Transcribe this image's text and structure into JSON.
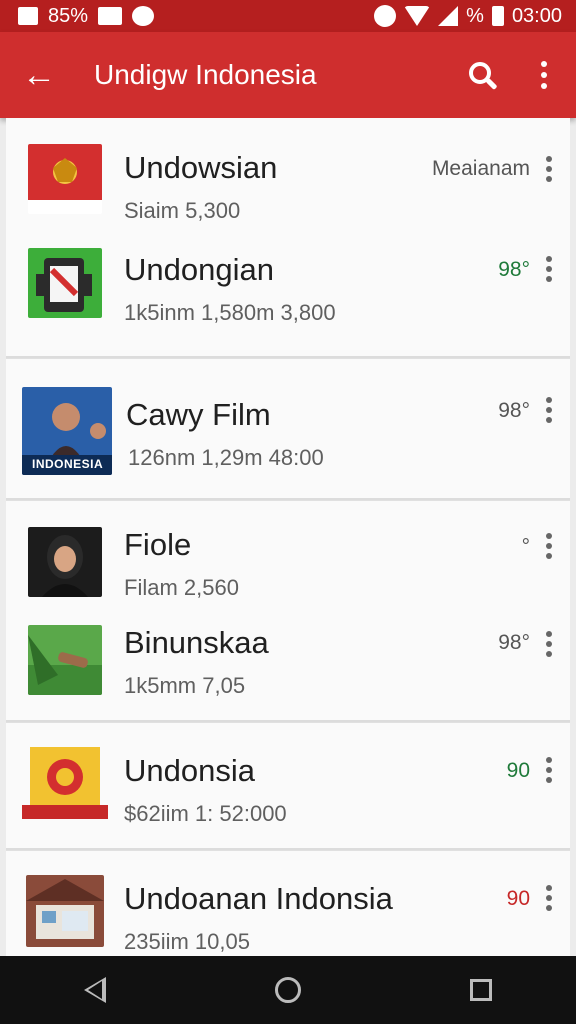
{
  "status_bar": {
    "battery_text": "85%",
    "signal_percent_text": "%",
    "clock": "03:00"
  },
  "app_bar": {
    "title": "Undigw Indonesia",
    "back_glyph": "←"
  },
  "items": [
    {
      "name": "Undowsian",
      "meta": "Siaim 5,300",
      "tag": "Meaianam",
      "tag_style": "gray",
      "thumb": "flag-emblem"
    },
    {
      "name": "Undongian",
      "meta": "1k5inm 1,580m 3,800",
      "tag": "98°",
      "tag_style": "green",
      "thumb": "phone-app"
    },
    {
      "name": "Cawy Film",
      "meta": "126nm 1,29m 48:00",
      "tag": "98°",
      "tag_style": "gray",
      "thumb": "movie-poster",
      "thumb_caption": "INDONESIA"
    },
    {
      "name": "Fiole",
      "meta": "Filam 2,560",
      "tag": "°",
      "tag_style": "gray",
      "thumb": "portrait"
    },
    {
      "name": "Binunskaa",
      "meta": "1k5mm 7,05",
      "tag": "98°",
      "tag_style": "gray",
      "thumb": "nature"
    },
    {
      "name": "Undonsia",
      "meta": "$62iim 1: 52:000",
      "tag": "90",
      "tag_style": "green",
      "thumb": "garuda-emblem"
    },
    {
      "name": "Undoanan Indonsia",
      "meta": "235iim 10,05",
      "tag": "90",
      "tag_style": "red",
      "thumb": "building"
    }
  ],
  "icons": {
    "back": "arrow-left-icon",
    "search": "search-icon",
    "overflow": "more-vert-icon",
    "nav_back": "triangle-back-icon",
    "nav_home": "circle-home-icon",
    "nav_recent": "square-recents-icon"
  },
  "colors": {
    "status_bar": "#b51f1f",
    "app_bar": "#cf2e2e",
    "tag_green": "#1f7a3a",
    "tag_red": "#c62828"
  }
}
